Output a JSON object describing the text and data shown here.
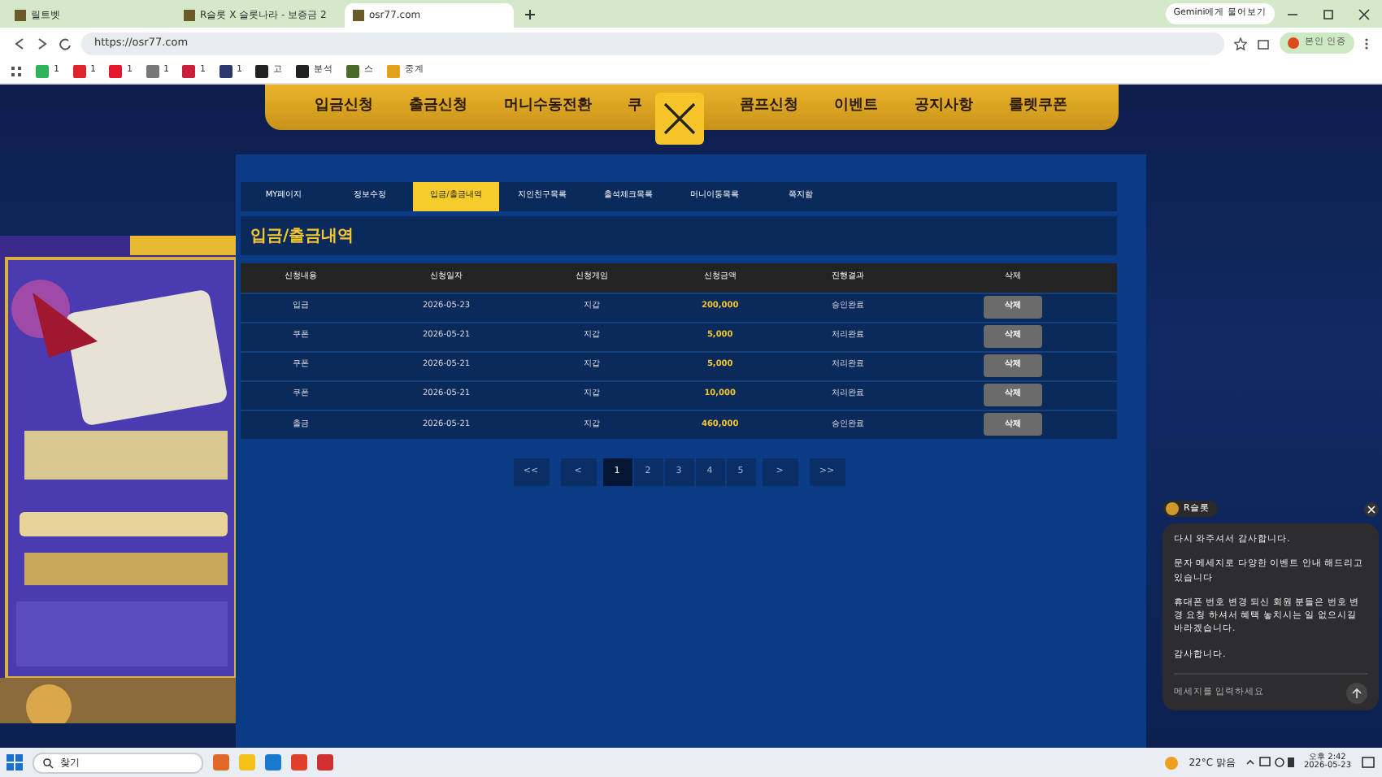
{
  "browser": {
    "tabs": [
      {
        "title": "릴트벳",
        "selected": false
      },
      {
        "title": "R슬롯 X 슬롯나라 - 보증금 2",
        "selected": false
      },
      {
        "title": "osr77.com",
        "selected": true
      }
    ],
    "gemini_button": "Gemini에게 물어보기",
    "address": "https://osr77.com",
    "profile_button": "본인 인증",
    "bookmarks": [
      {
        "label": "1",
        "color": "#2fb35a"
      },
      {
        "label": "1",
        "color": "#e0242b"
      },
      {
        "label": "1",
        "color": "#e3182d"
      },
      {
        "label": "1",
        "color": "#777777"
      },
      {
        "label": "1",
        "color": "#c8203a"
      },
      {
        "label": "1",
        "color": "#2a3a6a"
      },
      {
        "label": "고",
        "color": "#222222"
      },
      {
        "label": "분석",
        "color": "#222222"
      },
      {
        "label": "스",
        "color": "#4a6a2a"
      },
      {
        "label": "중계",
        "color": "#e2a21a"
      }
    ]
  },
  "site": {
    "nav": [
      "입금신청",
      "출금신청",
      "머니수동전환",
      "쿠",
      "콤프신청",
      "이벤트",
      "공지사항",
      "룰렛쿠폰"
    ],
    "subtabs": [
      {
        "label": "MY페이지",
        "selected": false
      },
      {
        "label": "정보수정",
        "selected": false
      },
      {
        "label": "입금/출금내역",
        "selected": true
      },
      {
        "label": "지인친구목록",
        "selected": false
      },
      {
        "label": "출석체크목록",
        "selected": false
      },
      {
        "label": "머니이동목록",
        "selected": false
      },
      {
        "label": "쪽지함",
        "selected": false
      }
    ],
    "section_title": "입금/출금내역",
    "table": {
      "columns": [
        "신청내용",
        "신청일자",
        "신청게임",
        "신청금액",
        "진행결과",
        "삭제"
      ],
      "rows": [
        [
          "입금",
          "2026-05-23",
          "지갑",
          "200,000",
          "승인완료",
          "삭제"
        ],
        [
          "쿠폰",
          "2026-05-21",
          "지갑",
          "5,000",
          "처리완료",
          "삭제"
        ],
        [
          "쿠폰",
          "2026-05-21",
          "지갑",
          "5,000",
          "처리완료",
          "삭제"
        ],
        [
          "쿠폰",
          "2026-05-21",
          "지갑",
          "10,000",
          "처리완료",
          "삭제"
        ],
        [
          "출금",
          "2026-05-21",
          "지갑",
          "460,000",
          "승인완료",
          "삭제"
        ]
      ]
    },
    "pagination": [
      {
        "label": "<<",
        "selected": false
      },
      {
        "label": "<",
        "selected": false
      },
      {
        "label": "1",
        "selected": true
      },
      {
        "label": "2",
        "selected": false
      },
      {
        "label": "3",
        "selected": false
      },
      {
        "label": "4",
        "selected": false
      },
      {
        "label": "5",
        "selected": false
      },
      {
        "label": ">",
        "selected": false
      },
      {
        "label": ">>",
        "selected": false
      }
    ],
    "popup_banner": {
      "kind": "picture"
    }
  },
  "chat": {
    "sender": "R슬롯",
    "messages": [
      "다시 와주셔서 감사합니다.",
      "문자 메세지로 다양한 이벤트 안내 해드리고 있습니다",
      "휴대폰 번호 변경 되신 회원 분들은 번호 변경 요청 하셔서 혜택 놓치시는 일 없으시길 바라겠습니다.",
      "감사합니다."
    ],
    "placeholder": "메세지를 입력하세요"
  },
  "taskbar": {
    "search": "찾기",
    "weather": "22°C 맑음",
    "time": "오후 2:42",
    "date": "2026-05-23"
  }
}
